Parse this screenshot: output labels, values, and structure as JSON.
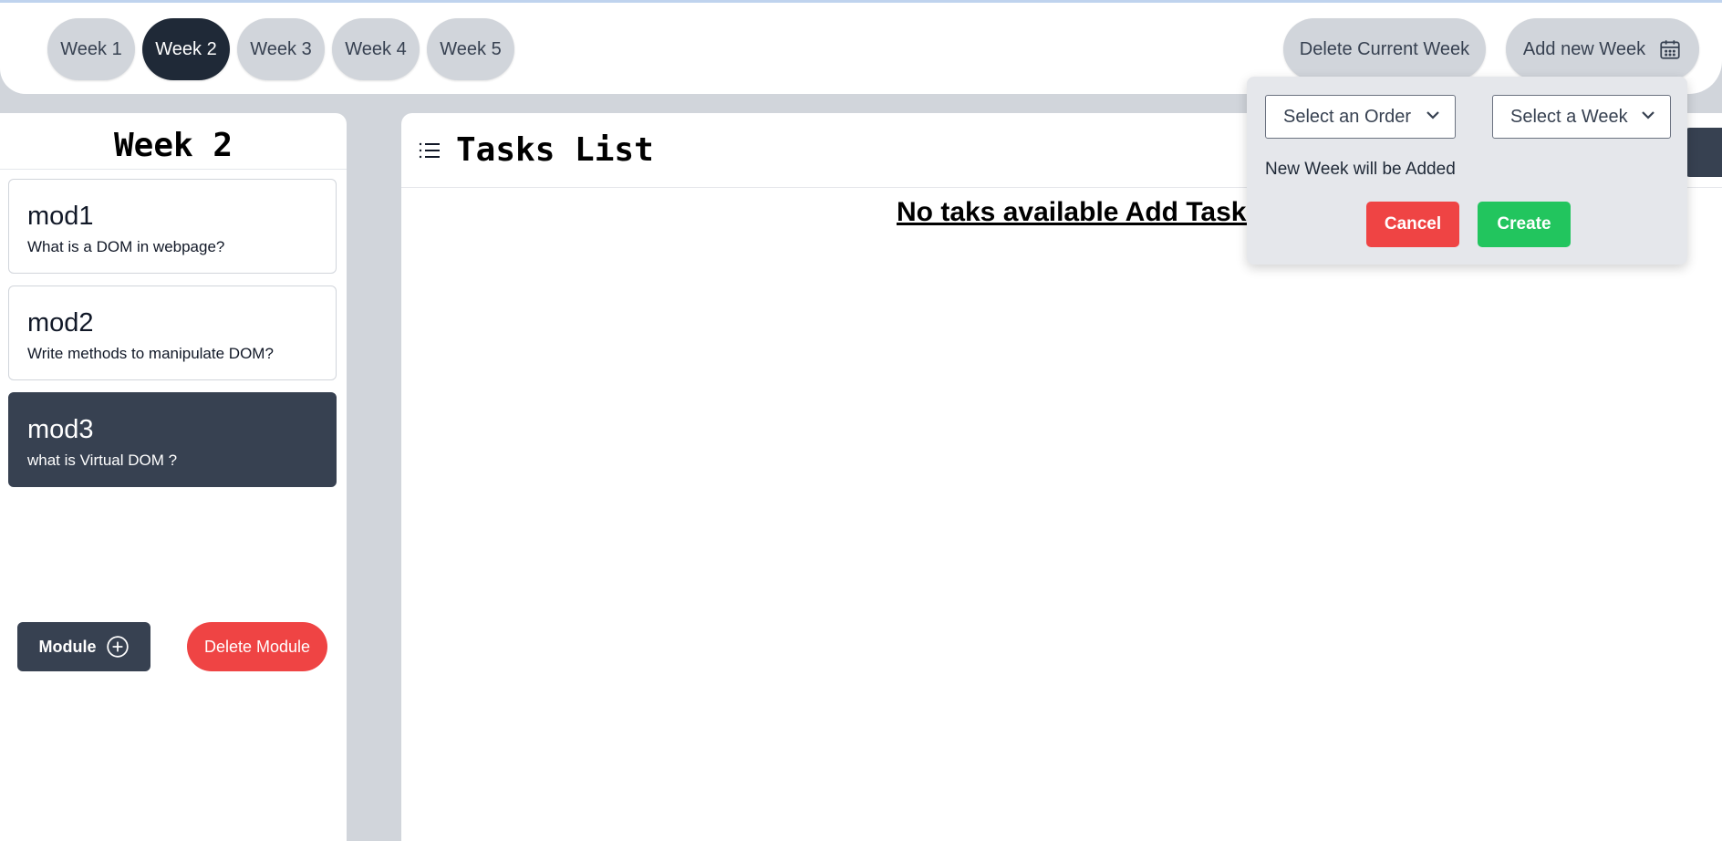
{
  "nav": {
    "weeks": [
      "Week 1",
      "Week 2",
      "Week 3",
      "Week 4",
      "Week 5"
    ],
    "active_week": "Week 2",
    "delete_week_label": "Delete Current Week",
    "add_week_label": "Add new Week",
    "add_week_icon": "calendar-icon"
  },
  "sidebar": {
    "title": "Week 2",
    "modules": [
      {
        "name": "mod1",
        "description": "What is a DOM in webpage?",
        "active": false
      },
      {
        "name": "mod2",
        "description": "Write methods to manipulate DOM?",
        "active": false
      },
      {
        "name": "mod3",
        "description": "what is Virtual DOM ?",
        "active": true
      }
    ],
    "add_module_label": "Module",
    "add_module_icon": "plus-circle-icon",
    "delete_module_label": "Delete Module"
  },
  "main": {
    "title": "Tasks List",
    "title_icon": "list-icon",
    "empty_message": "No taks available Add Tasks"
  },
  "popover": {
    "order_select": "Select an Order",
    "week_select": "Select a Week",
    "message": "New Week will be Added",
    "cancel_label": "Cancel",
    "create_label": "Create"
  },
  "colors": {
    "dark": "#1f2937",
    "slate": "#374151",
    "danger": "#ef4444",
    "success": "#22c55e",
    "pill": "#d1d5db"
  }
}
